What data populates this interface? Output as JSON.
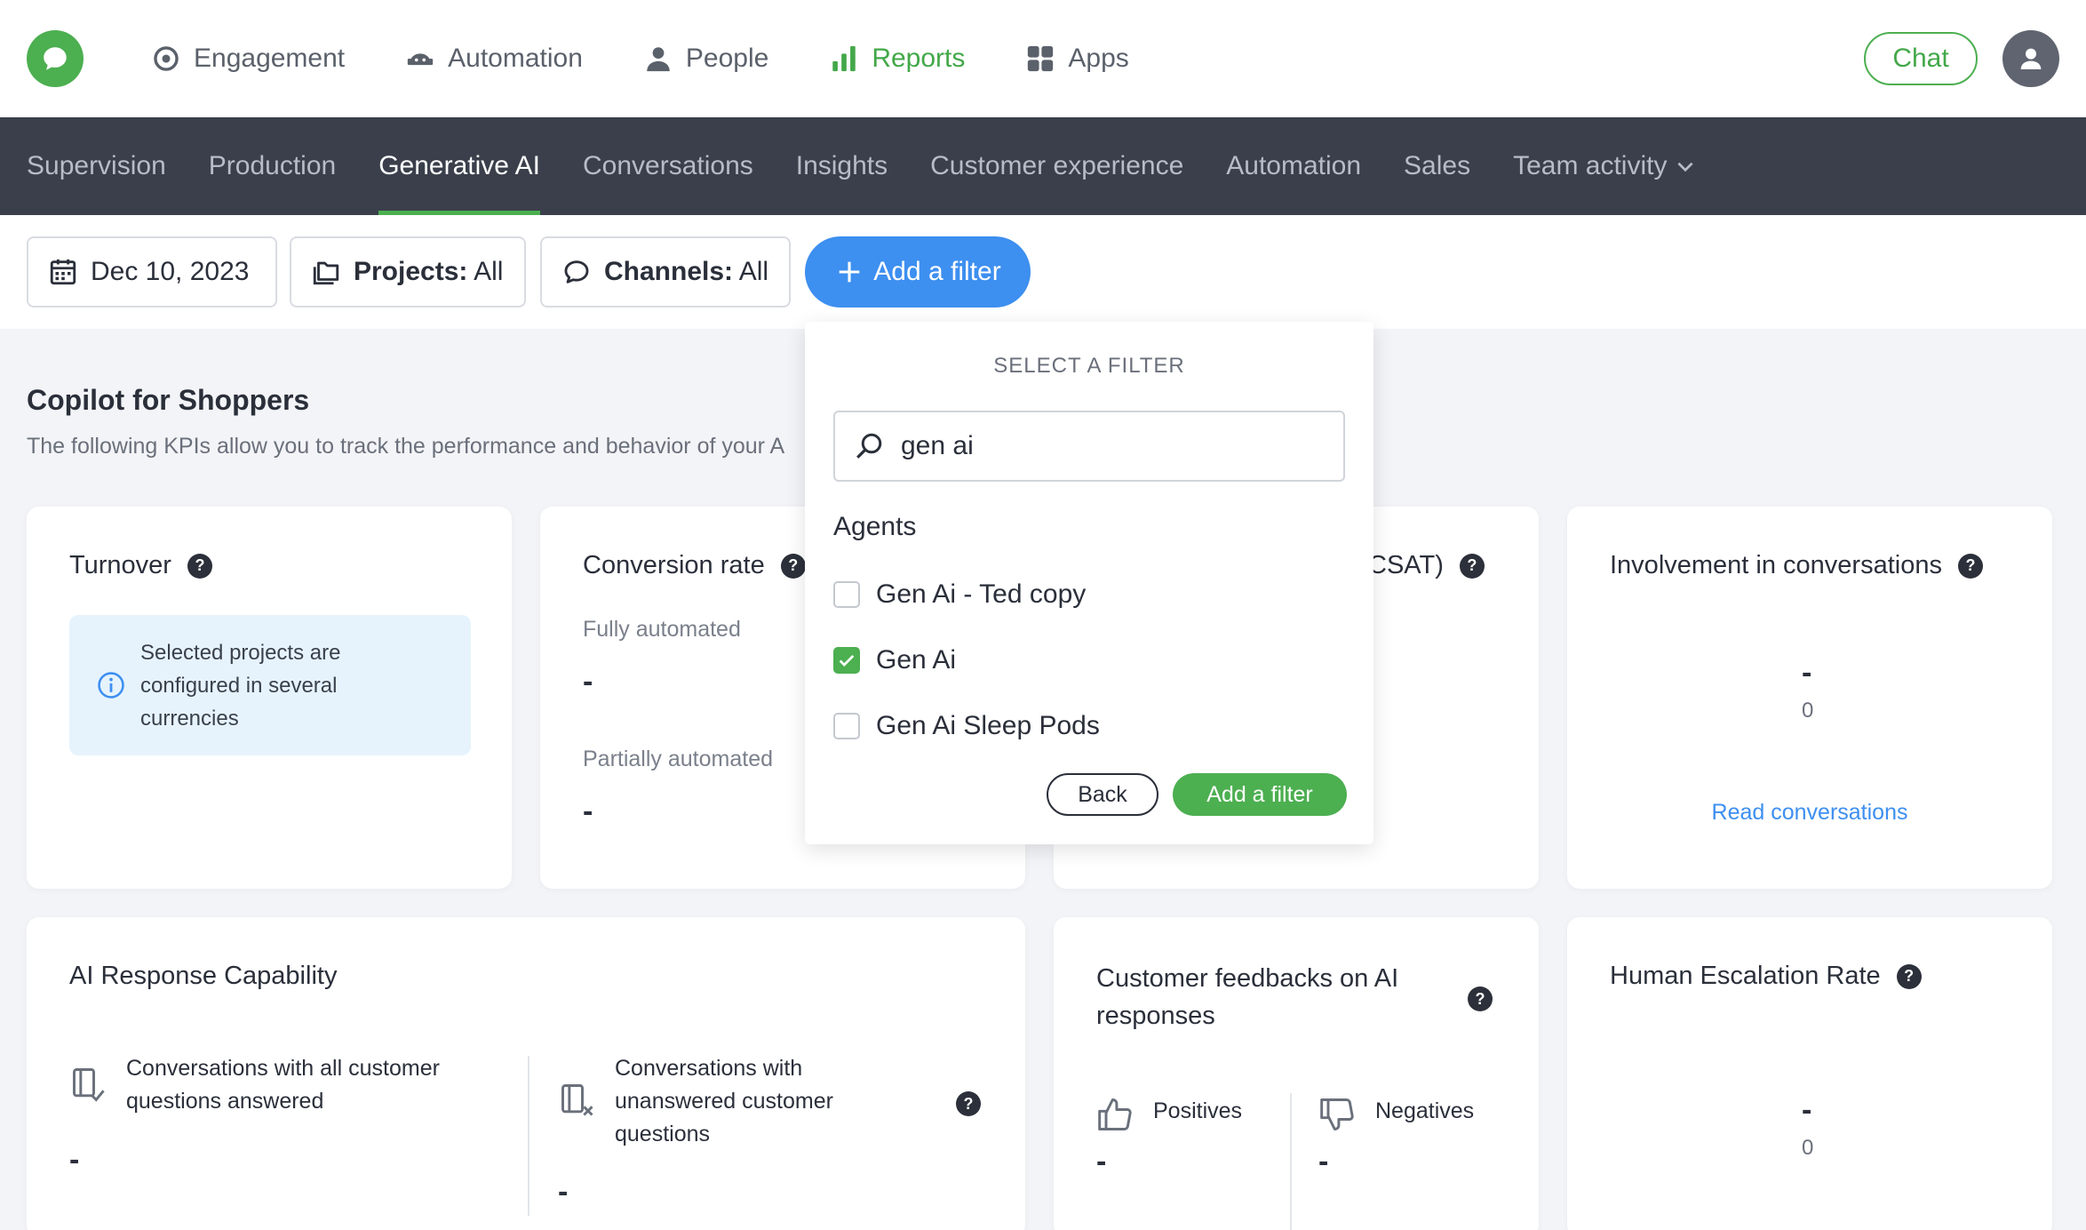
{
  "topnav": {
    "items": [
      {
        "label": "Engagement",
        "icon": "target-icon"
      },
      {
        "label": "Automation",
        "icon": "robot-icon"
      },
      {
        "label": "People",
        "icon": "person-icon"
      },
      {
        "label": "Reports",
        "icon": "bar-chart-icon",
        "active": true
      },
      {
        "label": "Apps",
        "icon": "grid-icon"
      }
    ],
    "chat_label": "Chat"
  },
  "tabs": [
    {
      "label": "Supervision"
    },
    {
      "label": "Production"
    },
    {
      "label": "Generative AI",
      "active": true
    },
    {
      "label": "Conversations"
    },
    {
      "label": "Insights"
    },
    {
      "label": "Customer experience"
    },
    {
      "label": "Automation"
    },
    {
      "label": "Sales"
    },
    {
      "label": "Team activity"
    }
  ],
  "filters": {
    "date": "Dec 10, 2023",
    "projects_label": "Projects:",
    "projects_value": "All",
    "channels_label": "Channels:",
    "channels_value": "All",
    "add_filter": "Add a filter"
  },
  "section": {
    "title": "Copilot for Shoppers",
    "subtitle": "The following KPIs allow you to track the performance and behavior of your A"
  },
  "cards": {
    "turnover": {
      "title": "Turnover",
      "info": "Selected projects are configured in several currencies"
    },
    "conversion": {
      "title": "Conversion rate",
      "fully": "Fully automated",
      "fully_value": "-",
      "partially": "Partially automated",
      "partially_value": "-"
    },
    "csat": {
      "title_partial": "CSAT)"
    },
    "involvement": {
      "title": "Involvement in conversations",
      "value": "-",
      "count": "0",
      "link": "Read conversations"
    },
    "ai_response": {
      "title": "AI Response Capability",
      "answered": "Conversations with all customer questions answered",
      "answered_value": "-",
      "unanswered": "Conversations with unanswered customer questions",
      "unanswered_value": "-"
    },
    "feedback": {
      "title": "Customer feedbacks on AI responses",
      "positives": "Positives",
      "positives_value": "-",
      "negatives": "Negatives",
      "negatives_value": "-"
    },
    "escalation": {
      "title": "Human Escalation Rate",
      "value": "-",
      "count": "0"
    }
  },
  "dropdown": {
    "title": "SELECT A FILTER",
    "search_value": "gen ai",
    "group": "Agents",
    "options": [
      {
        "label": "Gen Ai - Ted copy",
        "checked": false
      },
      {
        "label": "Gen Ai",
        "checked": true
      },
      {
        "label": "Gen Ai Sleep Pods",
        "checked": false
      }
    ],
    "back": "Back",
    "add": "Add a filter"
  },
  "colors": {
    "brand_green": "#4caf50",
    "accent_blue": "#3d8ff0",
    "tabbar_bg": "#3a3f4b"
  }
}
